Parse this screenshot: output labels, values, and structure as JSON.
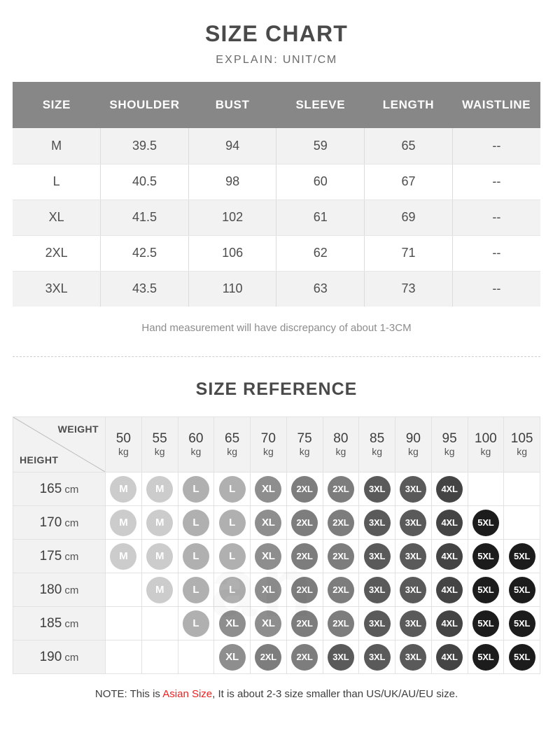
{
  "size_chart": {
    "title": "SIZE CHART",
    "subtitle_label": "EXPLAIN:",
    "subtitle_value": "UNIT/CM",
    "columns": [
      "SIZE",
      "SHOULDER",
      "BUST",
      "SLEEVE",
      "LENGTH",
      "WAISTLINE"
    ],
    "rows": [
      {
        "size": "M",
        "shoulder": "39.5",
        "bust": "94",
        "sleeve": "59",
        "length": "65",
        "waistline": "--"
      },
      {
        "size": "L",
        "shoulder": "40.5",
        "bust": "98",
        "sleeve": "60",
        "length": "67",
        "waistline": "--"
      },
      {
        "size": "XL",
        "shoulder": "41.5",
        "bust": "102",
        "sleeve": "61",
        "length": "69",
        "waistline": "--"
      },
      {
        "size": "2XL",
        "shoulder": "42.5",
        "bust": "106",
        "sleeve": "62",
        "length": "71",
        "waistline": "--"
      },
      {
        "size": "3XL",
        "shoulder": "43.5",
        "bust": "110",
        "sleeve": "63",
        "length": "73",
        "waistline": "--"
      }
    ],
    "hand_note": "Hand measurement will have discrepancy of about 1-3CM"
  },
  "size_reference": {
    "title": "SIZE REFERENCE",
    "corner": {
      "weight_label": "WEIGHT",
      "height_label": "HEIGHT"
    },
    "weight_unit": "kg",
    "weights": [
      "50",
      "55",
      "60",
      "65",
      "70",
      "75",
      "80",
      "85",
      "90",
      "95",
      "100",
      "105"
    ],
    "height_unit": "cm",
    "rows": [
      {
        "height": "165",
        "cells": [
          "M",
          "M",
          "L",
          "L",
          "XL",
          "2XL",
          "2XL",
          "3XL",
          "3XL",
          "4XL",
          "",
          ""
        ]
      },
      {
        "height": "170",
        "cells": [
          "M",
          "M",
          "L",
          "L",
          "XL",
          "2XL",
          "2XL",
          "3XL",
          "3XL",
          "4XL",
          "5XL",
          ""
        ]
      },
      {
        "height": "175",
        "cells": [
          "M",
          "M",
          "L",
          "L",
          "XL",
          "2XL",
          "2XL",
          "3XL",
          "3XL",
          "4XL",
          "5XL",
          "5XL"
        ]
      },
      {
        "height": "180",
        "cells": [
          "",
          "M",
          "L",
          "L",
          "XL",
          "2XL",
          "2XL",
          "3XL",
          "3XL",
          "4XL",
          "5XL",
          "5XL"
        ]
      },
      {
        "height": "185",
        "cells": [
          "",
          "",
          "L",
          "XL",
          "XL",
          "2XL",
          "2XL",
          "3XL",
          "3XL",
          "4XL",
          "5XL",
          "5XL"
        ]
      },
      {
        "height": "190",
        "cells": [
          "",
          "",
          "",
          "XL",
          "2XL",
          "2XL",
          "3XL",
          "3XL",
          "3XL",
          "4XL",
          "5XL",
          "5XL"
        ]
      }
    ],
    "badge_colors": {
      "M": "#cccccc",
      "L": "#b0b0b0",
      "XL": "#8e8e8e",
      "2XL": "#7d7d7d",
      "3XL": "#5a5a5a",
      "4XL": "#444444",
      "5XL": "#1c1c1c"
    }
  },
  "bottom_note": {
    "prefix": "NOTE: This is ",
    "accent": "Asian Size",
    "suffix": ", It is about 2-3 size smaller than US/UK/AU/EU size."
  },
  "theme": {
    "header_gray": "#878787",
    "row_alt": "#f2f2f2",
    "accent_red": "#f02020"
  }
}
